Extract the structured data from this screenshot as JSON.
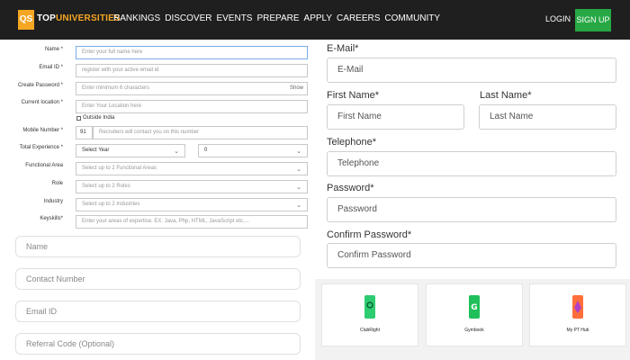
{
  "header": {
    "logo_mark": "QS",
    "logo_top": "TOP",
    "logo_rest": "UNIVERSITIES",
    "nav": [
      "RANKINGS",
      "DISCOVER",
      "EVENTS",
      "PREPARE",
      "APPLY",
      "CAREERS",
      "COMMUNITY"
    ],
    "login": "LOGIN",
    "signup": "SIGN UP"
  },
  "left_form": {
    "name_label": "Name *",
    "name_ph": "Enter your full name here",
    "email_label": "Email ID *",
    "email_ph": "register with your active email id",
    "password_label": "Create Password *",
    "password_ph": "Enter minimum 6 characters",
    "show": "Show",
    "location_label": "Current location *",
    "location_ph": "Enter Your Location here",
    "outside_india": "Outside India",
    "mobile_label": "Mobile Number *",
    "mobile_code": "91",
    "mobile_ph": "Recruiters will contact you on this number",
    "exp_label": "Total Experience *",
    "exp_year": "Select Year",
    "exp_month": "0",
    "func_label": "Functional Area",
    "func_ph": "Select up to 2 Functional Areas",
    "role_label": "Role",
    "role_ph": "Select up to 2 Roles",
    "industry_label": "Industry",
    "industry_ph": "Select up to 2 Industries",
    "keyskills_label": "Keyskills*",
    "keyskills_ph": "Enter your areas of expertise. EX: Java, Php, HTML, JavaScript etc....",
    "bottom_fields": [
      "Name",
      "Contact Number",
      "Email ID",
      "Referral Code (Optional)"
    ]
  },
  "right_form": {
    "email_label": "E-Mail*",
    "email_ph": "E-Mail",
    "first_label": "First Name*",
    "first_ph": "First Name",
    "last_label": "Last Name*",
    "last_ph": "Last Name",
    "tel_label": "Telephone*",
    "tel_ph": "Telephone",
    "pwd_label": "Password*",
    "pwd_ph": "Password",
    "cpwd_label": "Confirm Password*",
    "cpwd_ph": "Confirm Password"
  },
  "apps": [
    {
      "name": "ClubRight",
      "color": "#2ecc71"
    },
    {
      "name": "Gymbook",
      "color": "#1fbf5a"
    },
    {
      "name": "My PT Hub",
      "color": "#ff6f3c"
    }
  ]
}
